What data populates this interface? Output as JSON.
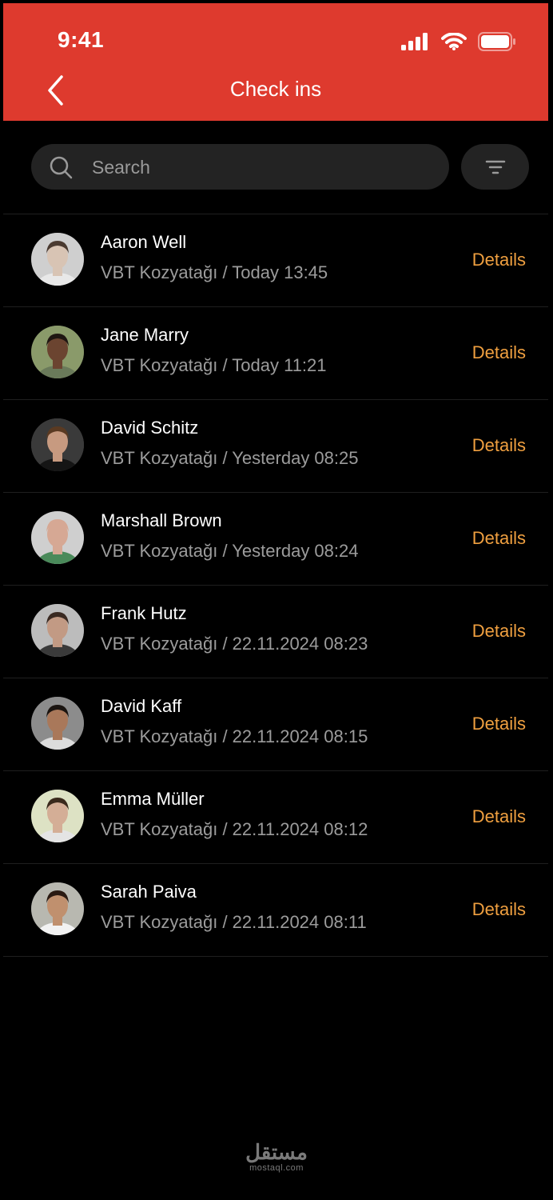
{
  "status": {
    "time": "9:41"
  },
  "header": {
    "title": "Check ins"
  },
  "search": {
    "placeholder": "Search"
  },
  "checkins": [
    {
      "name": "Aaron Well",
      "sub": "VBT Kozyatağı / Today 13:45",
      "action": "Details",
      "skin": "#d8c4b4",
      "hair": "#4a3a30",
      "shirt": "#e8e8e8",
      "bg": "#cfcfcf"
    },
    {
      "name": "Jane Marry",
      "sub": "VBT Kozyatağı / Today 11:21",
      "action": "Details",
      "skin": "#6b4430",
      "hair": "#1f1612",
      "shirt": "#6a7a5a",
      "bg": "#8a9a6a"
    },
    {
      "name": "David Schitz",
      "sub": "VBT Kozyatağı / Yesterday 08:25",
      "action": "Details",
      "skin": "#c79a80",
      "hair": "#5a3a22",
      "shirt": "#151515",
      "bg": "#3a3a3a"
    },
    {
      "name": "Marshall Brown",
      "sub": "VBT Kozyatağı / Yesterday 08:24",
      "action": "Details",
      "skin": "#d6a894",
      "hair": "#d6a894",
      "shirt": "#4a8a5a",
      "bg": "#cfcfcf"
    },
    {
      "name": "Frank Hutz",
      "sub": "VBT Kozyatağı / 22.11.2024 08:23",
      "action": "Details",
      "skin": "#c29a84",
      "hair": "#3a2a22",
      "shirt": "#3a3a3a",
      "bg": "#bcbcbc"
    },
    {
      "name": "David Kaff",
      "sub": "VBT Kozyatağı / 22.11.2024 08:15",
      "action": "Details",
      "skin": "#a9785a",
      "hair": "#1a1410",
      "shirt": "#dcdcdc",
      "bg": "#8c8c8c"
    },
    {
      "name": "Emma Müller",
      "sub": "VBT Kozyatağı / 22.11.2024 08:12",
      "action": "Details",
      "skin": "#d4ae96",
      "hair": "#3a2a1c",
      "shirt": "#e4e4e4",
      "bg": "#dde2c4"
    },
    {
      "name": "Sarah Paiva",
      "sub": "VBT Kozyatağı / 22.11.2024 08:11",
      "action": "Details",
      "skin": "#c0906e",
      "hair": "#2a1a12",
      "shirt": "#f2f2f2",
      "bg": "#b8b8b0"
    }
  ],
  "watermark": {
    "main": "مستقل",
    "sub": "mostaql.com"
  },
  "colors": {
    "header": "#de3a2e",
    "accent": "#f0a040",
    "background": "#000000"
  },
  "icons": {
    "back": "chevron-left-icon",
    "search": "search-icon",
    "filter": "filter-icon",
    "signal": "cellular-signal-icon",
    "wifi": "wifi-icon",
    "battery": "battery-icon"
  }
}
